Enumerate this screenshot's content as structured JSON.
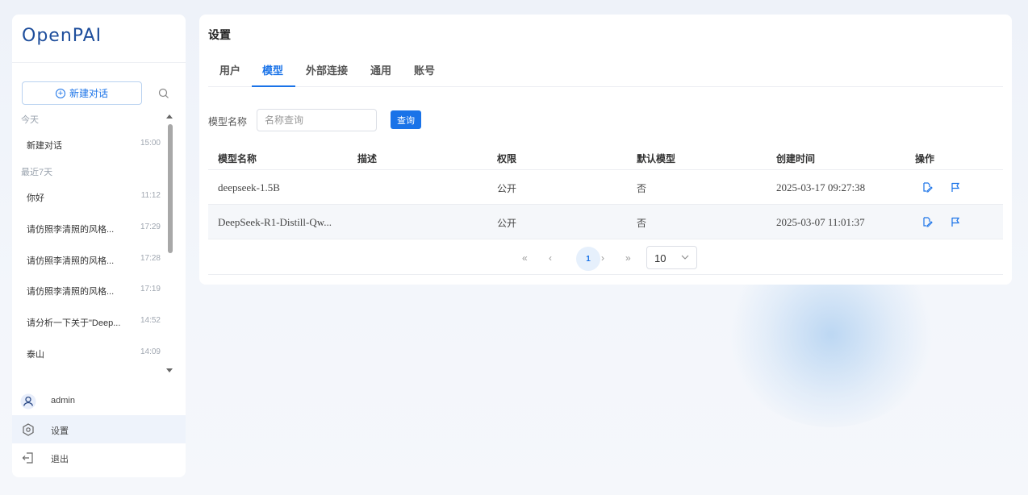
{
  "app": {
    "logo": "OpenPAI"
  },
  "sidebar": {
    "new_chat_label": "新建对话",
    "groups": [
      {
        "label": "今天",
        "items": [
          {
            "title": "新建对话",
            "time": "15:00"
          }
        ]
      },
      {
        "label": "最近7天",
        "items": [
          {
            "title": "你好",
            "time": "11:12"
          },
          {
            "title": "请仿照李清照的风格...",
            "time": "17:29"
          },
          {
            "title": "请仿照李清照的风格...",
            "time": "17:28"
          },
          {
            "title": "请仿照李清照的风格...",
            "time": "17:19"
          },
          {
            "title": "请分析一下关于\"Deep...",
            "time": "14:52"
          },
          {
            "title": "泰山",
            "time": "14:09"
          }
        ]
      }
    ],
    "user": "admin",
    "settings_label": "设置",
    "logout_label": "退出"
  },
  "main": {
    "title": "设置",
    "tabs": [
      "用户",
      "模型",
      "外部连接",
      "通用",
      "账号"
    ],
    "active_tab": "模型",
    "filter": {
      "label": "模型名称",
      "placeholder": "名称查询",
      "button": "查询"
    },
    "table": {
      "headers": [
        "模型名称",
        "描述",
        "权限",
        "默认模型",
        "创建时间",
        "操作"
      ],
      "rows": [
        {
          "name": "deepseek-1.5B",
          "desc": "",
          "permission": "公开",
          "default": "否",
          "created": "2025-03-17 09:27:38"
        },
        {
          "name": "DeepSeek-R1-Distill-Qw...",
          "desc": "",
          "permission": "公开",
          "default": "否",
          "created": "2025-03-07 11:01:37"
        }
      ]
    },
    "pagination": {
      "current_page": "1",
      "page_size": "10"
    }
  },
  "colors": {
    "accent": "#1a73e8",
    "logo": "#1e4e9c"
  }
}
